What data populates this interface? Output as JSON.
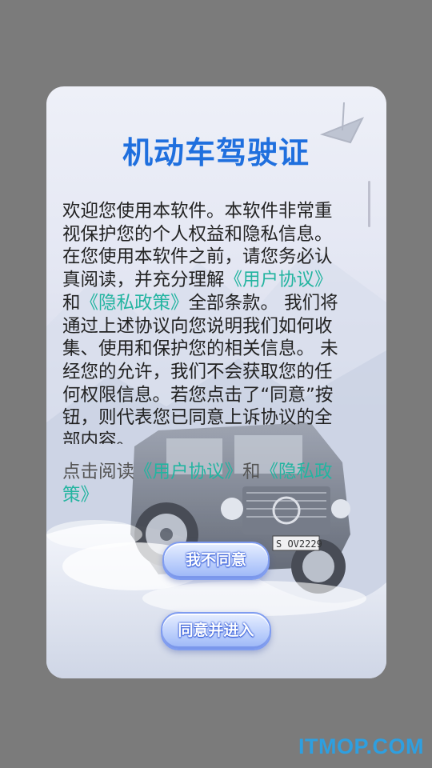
{
  "dialog": {
    "title": "机动车驾驶证",
    "body_lines": [
      "欢迎您使用本软件。本软件非常重",
      "视保护您的个人权益和隐私信息。",
      "在您使用本软件之前，请您务必认",
      "真阅读，并充分理解",
      "《用户协议》",
      "和",
      "《隐私政策》",
      "全部条款。 我们将",
      "通过上述协议向您说明我们如何收",
      "集、使用和保护您的相关信息。 未",
      "经您的允许，我们不会获取您的任",
      "何权限信息。若您点击了“同意”按",
      "钮，则代表您已同意上诉协议的全",
      "部内容。"
    ],
    "consent": {
      "prefix": "点击阅读",
      "user_agreement": "《用户协议》",
      "and": "和",
      "privacy_part1": "《隐私政",
      "privacy_part2": "策》"
    },
    "decline_label": "我不同意",
    "accept_label": "同意并进入"
  },
  "plate_text": "S  OV2229",
  "watermark": "ITMOP.COM",
  "colors": {
    "title": "#1f6fde",
    "link": "#23b4a0",
    "button": "#9bb6f7"
  }
}
